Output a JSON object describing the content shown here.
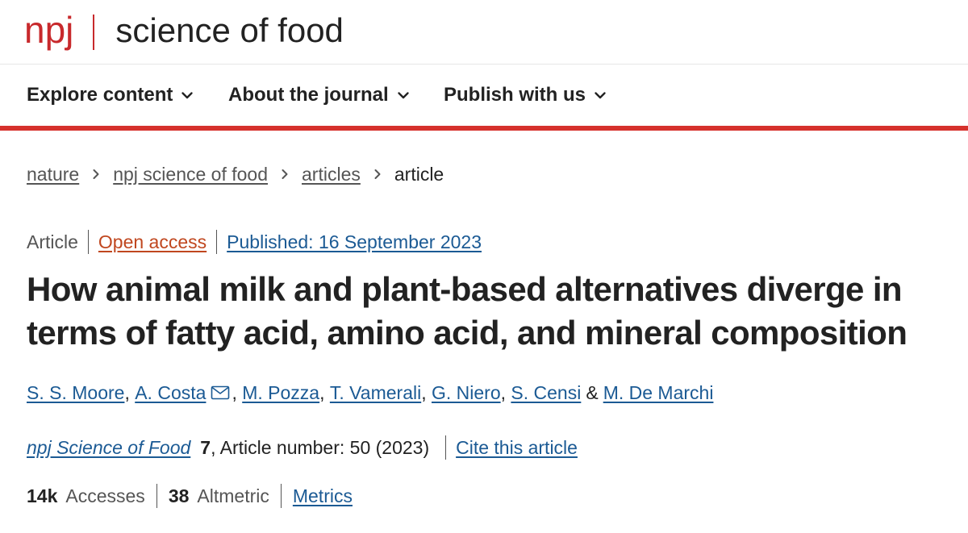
{
  "header": {
    "logo_npj": "npj",
    "logo_name": "science of food"
  },
  "nav": {
    "items": [
      {
        "label": "Explore content",
        "icon": "chevron-down-icon"
      },
      {
        "label": "About the journal",
        "icon": "chevron-down-icon"
      },
      {
        "label": "Publish with us",
        "icon": "chevron-down-icon"
      }
    ]
  },
  "breadcrumb": {
    "items": [
      "nature",
      "npj science of food",
      "articles"
    ],
    "current": "article",
    "separator_icon": "chevron-right-icon"
  },
  "article": {
    "type": "Article",
    "access": "Open access",
    "published": "Published: 16 September 2023",
    "title": "How animal milk and plant-based alternatives diverge in terms of fatty acid, amino acid, and mineral composition",
    "authors": [
      {
        "name": "S. S. Moore",
        "sep": ","
      },
      {
        "name": "A. Costa",
        "sep": ",",
        "contact_icon": "mail-icon"
      },
      {
        "name": "M. Pozza",
        "sep": ","
      },
      {
        "name": "T. Vamerali",
        "sep": ","
      },
      {
        "name": "G. Niero",
        "sep": ","
      },
      {
        "name": "S. Censi",
        "sep": ""
      },
      {
        "name": "M. De Marchi",
        "sep": ""
      }
    ],
    "authors_ampersand": "&",
    "citation": {
      "journal": "npj Science of Food",
      "volume": "7",
      "article_number": ", Article number: 50 (2023)",
      "cite_label": "Cite this article"
    },
    "metrics": {
      "accesses_value": "14k",
      "accesses_label": "Accesses",
      "altmetric_value": "38",
      "altmetric_label": "Altmetric",
      "metrics_link": "Metrics"
    }
  },
  "colors": {
    "brand_red": "#c8292c",
    "nav_rule": "#d6312c",
    "link_blue": "#1b5a94",
    "open_access_orange": "#c0471f",
    "text_dark": "#222222",
    "text_muted": "#555555"
  }
}
